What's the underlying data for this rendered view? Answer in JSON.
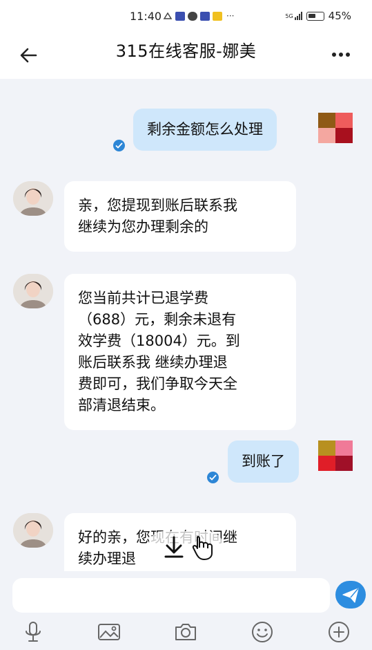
{
  "status_bar": {
    "time": "11:40",
    "overflow": "···",
    "network": "5G",
    "battery": "45%"
  },
  "header": {
    "title": "315在线客服-娜美"
  },
  "messages": [
    {
      "side": "me",
      "text": "剩余金额怎么处理",
      "read": true
    },
    {
      "side": "them",
      "lines": [
        "亲，您提现到账后联系我",
        "继续为您办理剩余的"
      ]
    },
    {
      "side": "them",
      "lines": [
        "您当前共计已退学费",
        "（688）元，剩余未退有",
        "效学费（18004）元。到",
        "账后联系我 继续办理退",
        "费即可，我们争取今天全",
        "部清退结束。"
      ]
    },
    {
      "side": "me",
      "text": "到账了",
      "read": true
    },
    {
      "side": "them",
      "lines": [
        "好的亲，您现在有时间继",
        "续办理退"
      ]
    }
  ],
  "input": {
    "value": "",
    "placeholder": ""
  },
  "toolbar": {
    "icons": [
      "microphone-icon",
      "image-icon",
      "camera-icon",
      "emoji-icon",
      "plus-icon"
    ]
  },
  "colors": {
    "my_bubble": "#cfe7fb",
    "their_bubble": "#ffffff",
    "chat_background": "#f1f3f8",
    "accent": "#2d8de0"
  }
}
